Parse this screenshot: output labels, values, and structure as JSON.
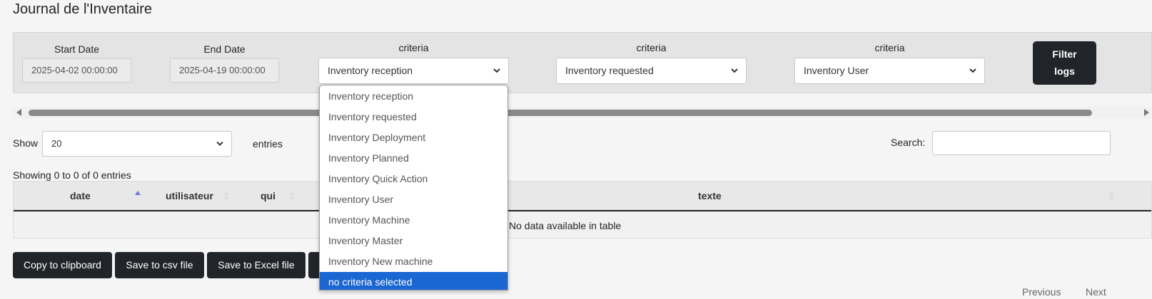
{
  "page": {
    "title": "Journal de l'Inventaire"
  },
  "filters": {
    "start_date": {
      "label": "Start Date",
      "value": "2025-04-02 00:00:00"
    },
    "end_date": {
      "label": "End Date",
      "value": "2025-04-19 00:00:00"
    },
    "criteria1": {
      "label": "criteria",
      "value": "Inventory reception"
    },
    "criteria2": {
      "label": "criteria",
      "value": "Inventory requested"
    },
    "criteria3": {
      "label": "criteria",
      "value": "Inventory User"
    },
    "filter_button": {
      "line1": "Filter",
      "line2": "logs"
    }
  },
  "dropdown": {
    "options": [
      "Inventory reception",
      "Inventory requested",
      "Inventory Deployment",
      "Inventory Planned",
      "Inventory Quick Action",
      "Inventory User",
      "Inventory Machine",
      "Inventory Master",
      "Inventory New machine",
      "no criteria selected"
    ],
    "highlighted": "no criteria selected"
  },
  "table_controls": {
    "show_label": "Show",
    "entries_value": "20",
    "entries_label": "entries",
    "search_label": "Search:",
    "info": "Showing 0 to 0 of 0 entries"
  },
  "table": {
    "columns": [
      "date",
      "utilisateur",
      "qui",
      "texte"
    ],
    "empty_message": "No data available in table"
  },
  "export_buttons": {
    "copy": "Copy to clipboard",
    "csv": "Save to csv file",
    "excel": "Save to Excel file"
  },
  "pagination": {
    "previous": "Previous",
    "next": "Next"
  },
  "colors": {
    "dark_button": "#212529",
    "dropdown_highlight": "#1a66d2",
    "sort_active": "#6f79d8"
  }
}
